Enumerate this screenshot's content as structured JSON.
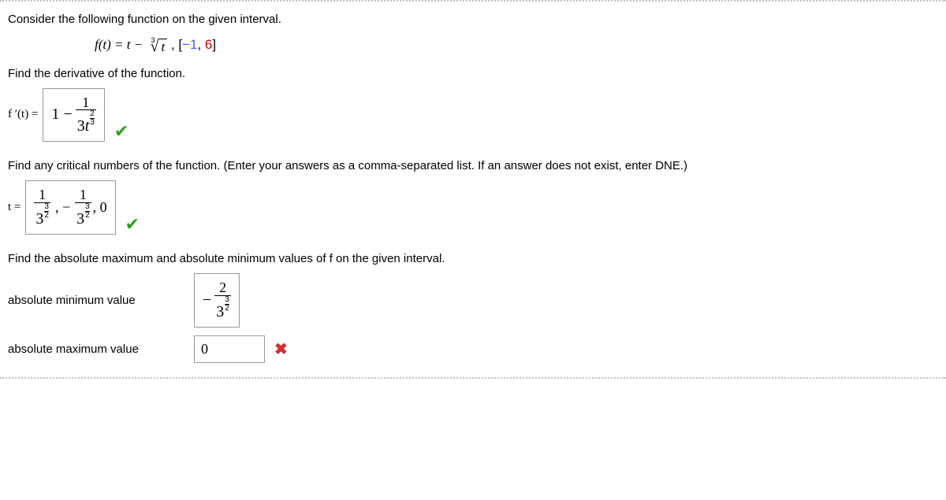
{
  "intro": "Consider the following function on the given interval.",
  "function_lhs": "f(t) = t − ",
  "radical_index": "3",
  "radical_radicand": "t",
  "interval_open": ",    [",
  "interval_neg1": "−1",
  "interval_comma": ", ",
  "interval_6": "6",
  "interval_close": "]",
  "derivative_prompt": "Find the derivative of the function.",
  "fprime_label": "f ′(t) = ",
  "fprime": {
    "pre": "1 − ",
    "num": "1",
    "den_coef": "3",
    "den_var": "t",
    "exp_n": "2",
    "exp_d": "3"
  },
  "critical_prompt": "Find any critical numbers of the function. (Enter your answers as a comma-separated list. If an answer does not exist, enter DNE.)",
  "t_label": "t = ",
  "crit": {
    "num": "1",
    "base_coef": "3",
    "exp_n": "3",
    "exp_d": "2",
    "sep1": ",  − ",
    "tail": ", 0"
  },
  "extrema_prompt": "Find the absolute maximum and absolute minimum values of f on the given interval.",
  "absmin_label": "absolute minimum value",
  "absmin": {
    "neg": "− ",
    "num": "2",
    "base_coef": "3",
    "exp_n": "3",
    "exp_d": "2"
  },
  "absmax_label": "absolute maximum value",
  "absmax_value": "0",
  "icons": {
    "check": "✔",
    "cross": "✖"
  }
}
